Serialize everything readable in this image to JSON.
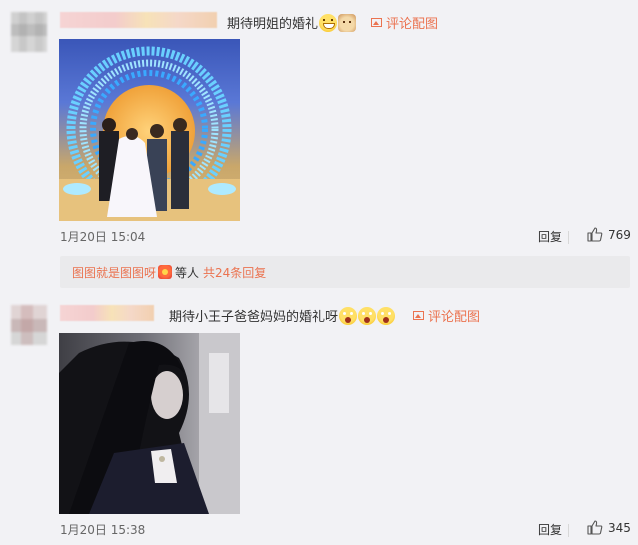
{
  "comments": [
    {
      "text": "期待明姐的婚礼",
      "emojis": [
        "grin-emoji",
        "cat-emoji"
      ],
      "pic_comment": "评论配图",
      "time": "1月20日 15:04",
      "reply_label": "回复",
      "likes": "769",
      "reply_summary": {
        "user": "图图就是图图呀",
        "others": "等人",
        "count": "共24条回复"
      }
    },
    {
      "text": "期待小王子爸爸妈妈的婚礼呀",
      "emojis": [
        "shocked-emoji",
        "shocked-emoji",
        "shocked-emoji"
      ],
      "pic_comment": "评论配图",
      "time": "1月20日 15:38",
      "reply_label": "回复",
      "likes": "345"
    }
  ],
  "colors": {
    "background": "#f2f2f5",
    "accent": "#eb7350",
    "text": "#333333",
    "muted": "#666666"
  }
}
